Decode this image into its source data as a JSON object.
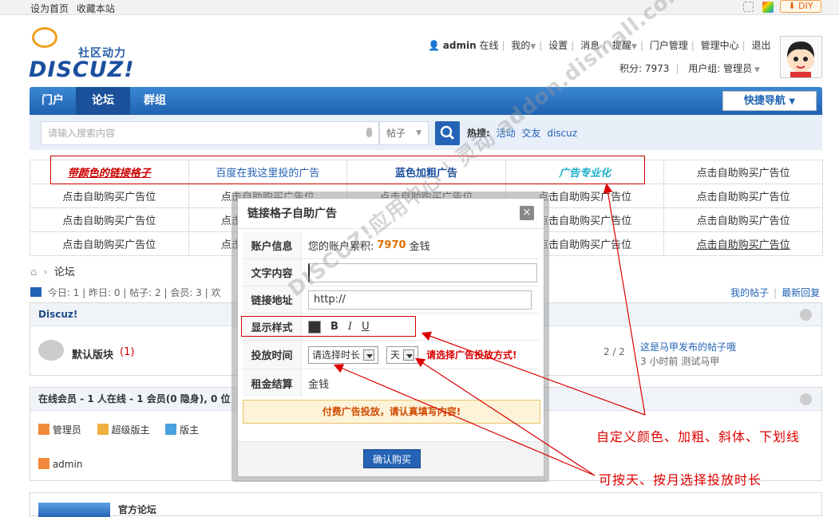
{
  "topbar": {
    "set_home": "设为首页",
    "bookmark": "收藏本站",
    "diy": "DIY"
  },
  "logo": {
    "tagline": "社区动力",
    "wordmark": "DISCUZ!"
  },
  "usernav": {
    "username": "admin",
    "online": "在线",
    "items": [
      "我的",
      "设置",
      "消息",
      "提醒",
      "门户管理",
      "管理中心",
      "退出"
    ],
    "points": "积分: 7973",
    "usergroup": "用户组: 管理员"
  },
  "nav": {
    "items": [
      "门户",
      "论坛",
      "群组"
    ],
    "quicknav": "快捷导航"
  },
  "search": {
    "placeholder": "请输入搜索内容",
    "type": "帖子",
    "hot_label": "热搜:",
    "hot_words": [
      "活动",
      "交友",
      "discuz"
    ]
  },
  "ads": {
    "row1": [
      "带颜色的链接格子",
      "百度在我这里投的广告",
      "蓝色加粗广告",
      "广告专业化",
      "点击自助购买广告位"
    ],
    "filler": "点击自助购买广告位"
  },
  "breadcrumb": {
    "current": "论坛"
  },
  "stats": {
    "text": "今日: 1 | 昨日: 0 | 帖子: 2 | 会员: 3 | 欢",
    "my_posts": "我的帖子",
    "latest_reply": "最新回复"
  },
  "forum_box": {
    "title": "Discuz!",
    "forum_name": "默认版块",
    "forum_count": "(1)",
    "ratio": "2 / 2",
    "last_post_title": "这是马甲发布的帖子哦",
    "last_post_meta": "3 小时前 测试马甲"
  },
  "online_box": {
    "title": "在线会员 - 1 人在线 - 1 会员(0 隐身), 0 位",
    "legend": [
      "管理员",
      "超级版主",
      "版主"
    ],
    "member": "admin"
  },
  "official_box": {
    "title": "官方论坛"
  },
  "dialog": {
    "title": "链接格子自助广告",
    "close": "×",
    "account_label": "账户信息",
    "account_text": "您的账户累积:",
    "account_amount": "7970",
    "account_unit": "金钱",
    "text_label": "文字内容",
    "text_value": "",
    "link_label": "链接地址",
    "link_value": "http://",
    "style_label": "显示样式",
    "style_bold": "B",
    "style_italic": "I",
    "style_underline": "U",
    "time_label": "投放时间",
    "duration_select": "请选择时长",
    "unit_select": "天",
    "time_hint": "请选择广告投放方式!",
    "rent_label": "租金结算",
    "rent_value": "金钱",
    "pay_notice": "付费广告投放，请认真填写内容!",
    "confirm": "确认购买"
  },
  "annotations": {
    "style_note": "自定义颜色、加粗、斜体、下划线",
    "time_note": "可按天、按月选择投放时长"
  },
  "watermark": "DISCUZ!应用中心 | 灵动 addon.dismall.com",
  "colors": {
    "brand_blue": "#1f62b2",
    "annotation_red": "#dd0000",
    "amount_orange": "#e07000"
  }
}
